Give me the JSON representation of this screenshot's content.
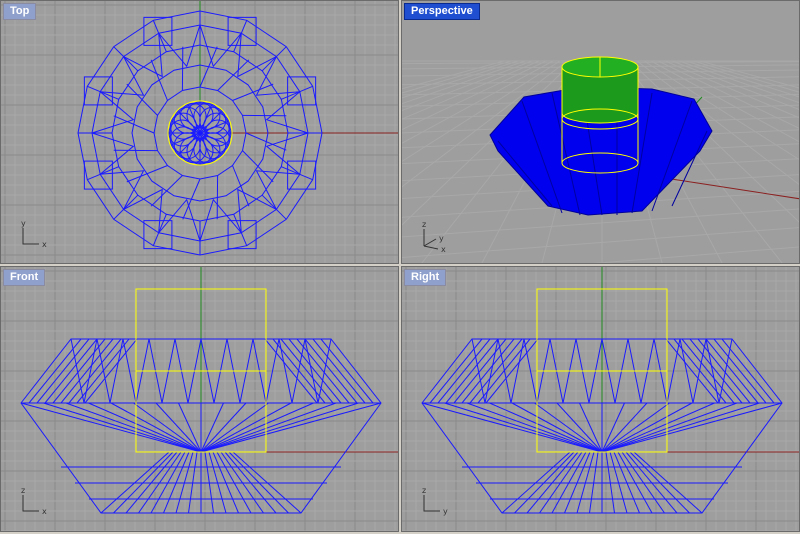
{
  "viewports": {
    "top": {
      "label": "Top",
      "axes": {
        "h": "x",
        "v": "y"
      }
    },
    "perspective": {
      "label": "Perspective",
      "active": true,
      "axes": {
        "a": "x",
        "b": "y",
        "c": "z"
      }
    },
    "front": {
      "label": "Front",
      "axes": {
        "h": "x",
        "v": "z"
      }
    },
    "right": {
      "label": "Right",
      "axes": {
        "h": "y",
        "v": "z"
      }
    }
  },
  "colors": {
    "viewport_bg": "#9e9e9e",
    "grid_minor": "#a8a8a8",
    "grid_major": "#8a8a8a",
    "wire": "#1a1aff",
    "selected": "#ffff00",
    "x_axis": "#8b2020",
    "y_axis": "#208b20",
    "cylinder_fill": "#1c9a1c",
    "solid_body": "#0000ee",
    "active_tab": "#1f4fd0",
    "inactive_tab": "#8fa0cc"
  }
}
